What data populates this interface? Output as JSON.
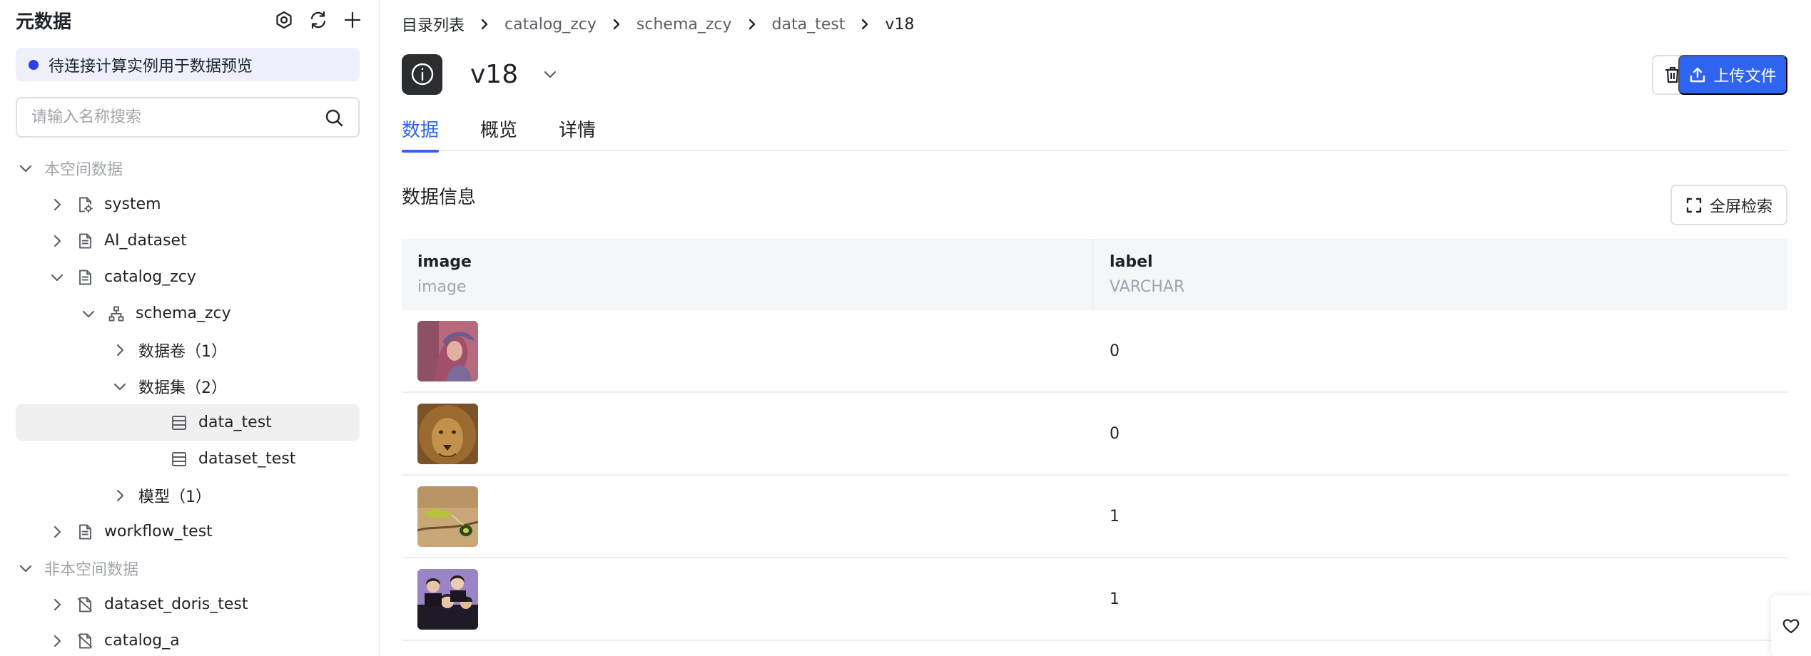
{
  "sidebar": {
    "title": "元数据",
    "notice": "待连接计算实例用于数据预览",
    "search_placeholder": "请输入名称搜索",
    "tree": [
      {
        "label": "本空间数据",
        "level": 0,
        "chevron": "down",
        "icon": "",
        "group": true
      },
      {
        "label": "system",
        "level": 1,
        "chevron": "right",
        "icon": "catalog-settings"
      },
      {
        "label": "AI_dataset",
        "level": 1,
        "chevron": "right",
        "icon": "catalog"
      },
      {
        "label": "catalog_zcy",
        "level": 1,
        "chevron": "down",
        "icon": "catalog"
      },
      {
        "label": "schema_zcy",
        "level": 2,
        "chevron": "down",
        "icon": "schema"
      },
      {
        "label": "数据卷（1）",
        "level": 3,
        "chevron": "right",
        "icon": ""
      },
      {
        "label": "数据集（2）",
        "level": 3,
        "chevron": "down",
        "icon": ""
      },
      {
        "label": "data_test",
        "level": 4,
        "chevron": "",
        "icon": "dataset",
        "selected": true
      },
      {
        "label": "dataset_test",
        "level": 4,
        "chevron": "",
        "icon": "dataset"
      },
      {
        "label": "模型（1）",
        "level": 3,
        "chevron": "right",
        "icon": ""
      },
      {
        "label": "workflow_test",
        "level": 1,
        "chevron": "right",
        "icon": "catalog"
      },
      {
        "label": "非本空间数据",
        "level": 0,
        "chevron": "down",
        "icon": "",
        "group": true
      },
      {
        "label": "dataset_doris_test",
        "level": 1,
        "chevron": "right",
        "icon": "catalog-external"
      },
      {
        "label": "catalog_a",
        "level": 1,
        "chevron": "right",
        "icon": "catalog-external"
      }
    ]
  },
  "breadcrumb": [
    "目录列表",
    "catalog_zcy",
    "schema_zcy",
    "data_test",
    "v18"
  ],
  "header": {
    "title": "v18",
    "upload_label": "上传文件"
  },
  "tabs": [
    {
      "label": "数据",
      "active": true
    },
    {
      "label": "概览",
      "active": false
    },
    {
      "label": "详情",
      "active": false
    }
  ],
  "section": {
    "title": "数据信息",
    "fullscreen_label": "全屏检索"
  },
  "table": {
    "columns": [
      {
        "name": "image",
        "type": "image"
      },
      {
        "name": "label",
        "type": "VARCHAR"
      }
    ],
    "rows": [
      {
        "image": "portrait-thumbnail",
        "label": "0"
      },
      {
        "image": "lion-thumbnail",
        "label": "0"
      },
      {
        "image": "chameleon-thumbnail",
        "label": "1"
      },
      {
        "image": "band-photo-thumbnail",
        "label": "1"
      }
    ]
  },
  "colors": {
    "accent": "#2e64f0",
    "notice_bg": "#eef0fb",
    "notice_dot": "#2f3ee8",
    "selected_bg": "#f0f0f1",
    "header_bg": "#f5f6f8"
  }
}
